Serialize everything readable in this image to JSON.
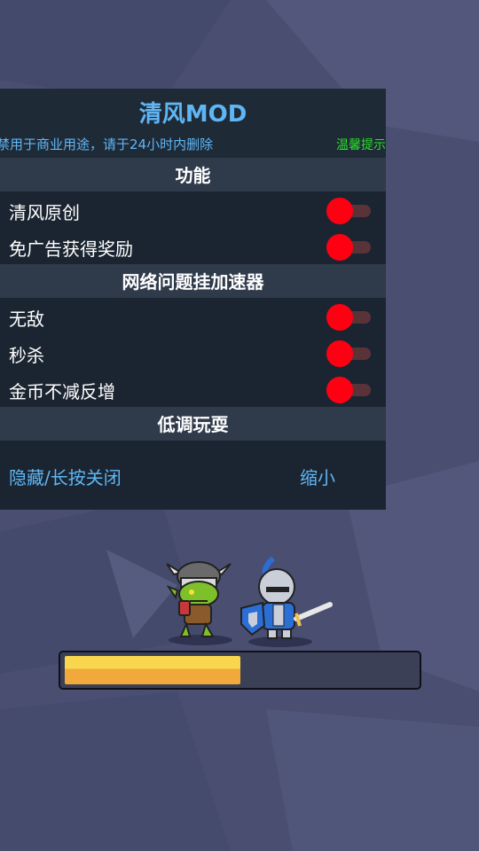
{
  "menu": {
    "title": "清风MOD",
    "notice": "禁用于商业用途，请于24小时内删除",
    "tip_label": "温馨提示",
    "sections": [
      {
        "header": "功能",
        "items": [
          {
            "label": "清风原创",
            "on": true
          },
          {
            "label": "免广告获得奖励",
            "on": true
          }
        ]
      },
      {
        "header": "网络问题挂加速器",
        "items": [
          {
            "label": "无敌",
            "on": true
          },
          {
            "label": "秒杀",
            "on": true
          },
          {
            "label": "金币不减反增",
            "on": true
          }
        ]
      }
    ],
    "footer_header": "低调玩耍",
    "hide_button": "隐藏/长按关闭",
    "shrink_button": "缩小"
  },
  "game": {
    "progress": 0.5,
    "characters": [
      "goblin-warrior",
      "blue-knight"
    ]
  },
  "colors": {
    "title": "#5fb6f5",
    "tip": "#28e228",
    "toggle_on": "#ff0012",
    "progress_top": "#f8d64d",
    "progress_bottom": "#f0a93a"
  }
}
